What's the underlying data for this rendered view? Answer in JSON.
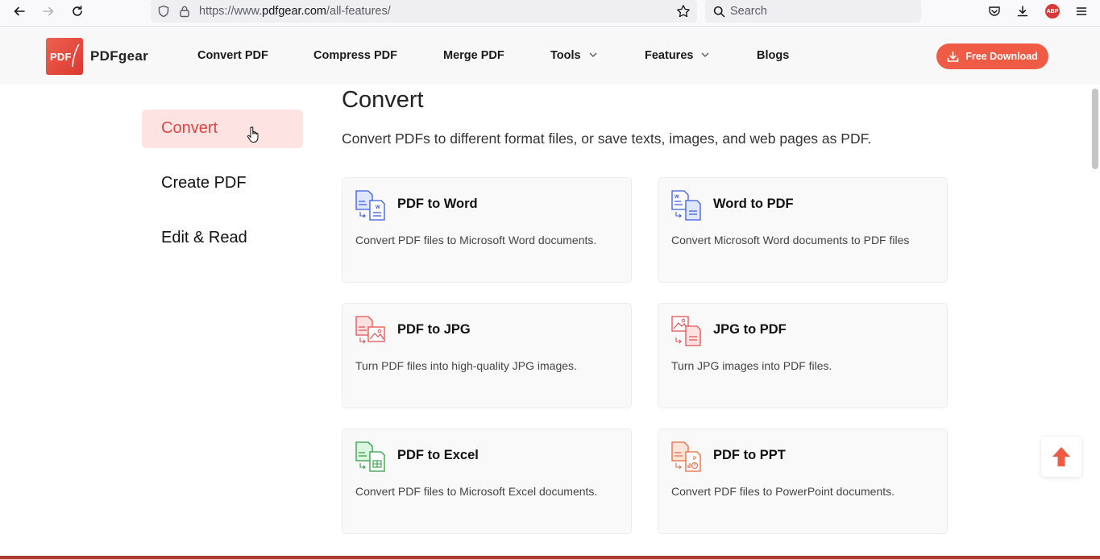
{
  "browser": {
    "url_prefix": "https://www.",
    "url_domain": "pdfgear.com",
    "url_path": "/all-features/",
    "search_placeholder": "Search",
    "adblock_label": "ABP"
  },
  "header": {
    "logo_mark": "PDF",
    "logo_name": "PDFgear",
    "nav": [
      {
        "label": "Convert PDF"
      },
      {
        "label": "Compress PDF"
      },
      {
        "label": "Merge PDF"
      },
      {
        "label": "Tools"
      },
      {
        "label": "Features"
      },
      {
        "label": "Blogs"
      }
    ],
    "download_label": "Free Download"
  },
  "sidebar": {
    "items": [
      {
        "label": "Convert",
        "active": true
      },
      {
        "label": "Create PDF",
        "active": false
      },
      {
        "label": "Edit & Read",
        "active": false
      }
    ]
  },
  "main": {
    "title": "Convert",
    "subtitle": "Convert PDFs to different format files, or save texts, images, and web pages as PDF.",
    "cards": [
      {
        "title": "PDF to Word",
        "desc": "Convert PDF files to Microsoft Word documents.",
        "icon": "pdf-to-word-icon"
      },
      {
        "title": "Word to PDF",
        "desc": "Convert Microsoft Word documents to PDF files",
        "icon": "word-to-pdf-icon"
      },
      {
        "title": "PDF to JPG",
        "desc": "Turn PDF files into high-quality JPG images.",
        "icon": "pdf-to-jpg-icon"
      },
      {
        "title": "JPG to PDF",
        "desc": "Turn JPG images into PDF files.",
        "icon": "jpg-to-pdf-icon"
      },
      {
        "title": "PDF to Excel",
        "desc": "Convert PDF files to Microsoft Excel documents.",
        "icon": "pdf-to-excel-icon"
      },
      {
        "title": "PDF to PPT",
        "desc": "Convert PDF files to PowerPoint documents.",
        "icon": "pdf-to-ppt-icon"
      }
    ]
  },
  "colors": {
    "accent": "#ef5b45",
    "active_bg": "#fde3e1",
    "active_text": "#e04444",
    "word_blue": "#3b5bdb",
    "jpg_red": "#e05252",
    "excel_green": "#2f9e44",
    "ppt_orange": "#e8683a"
  }
}
